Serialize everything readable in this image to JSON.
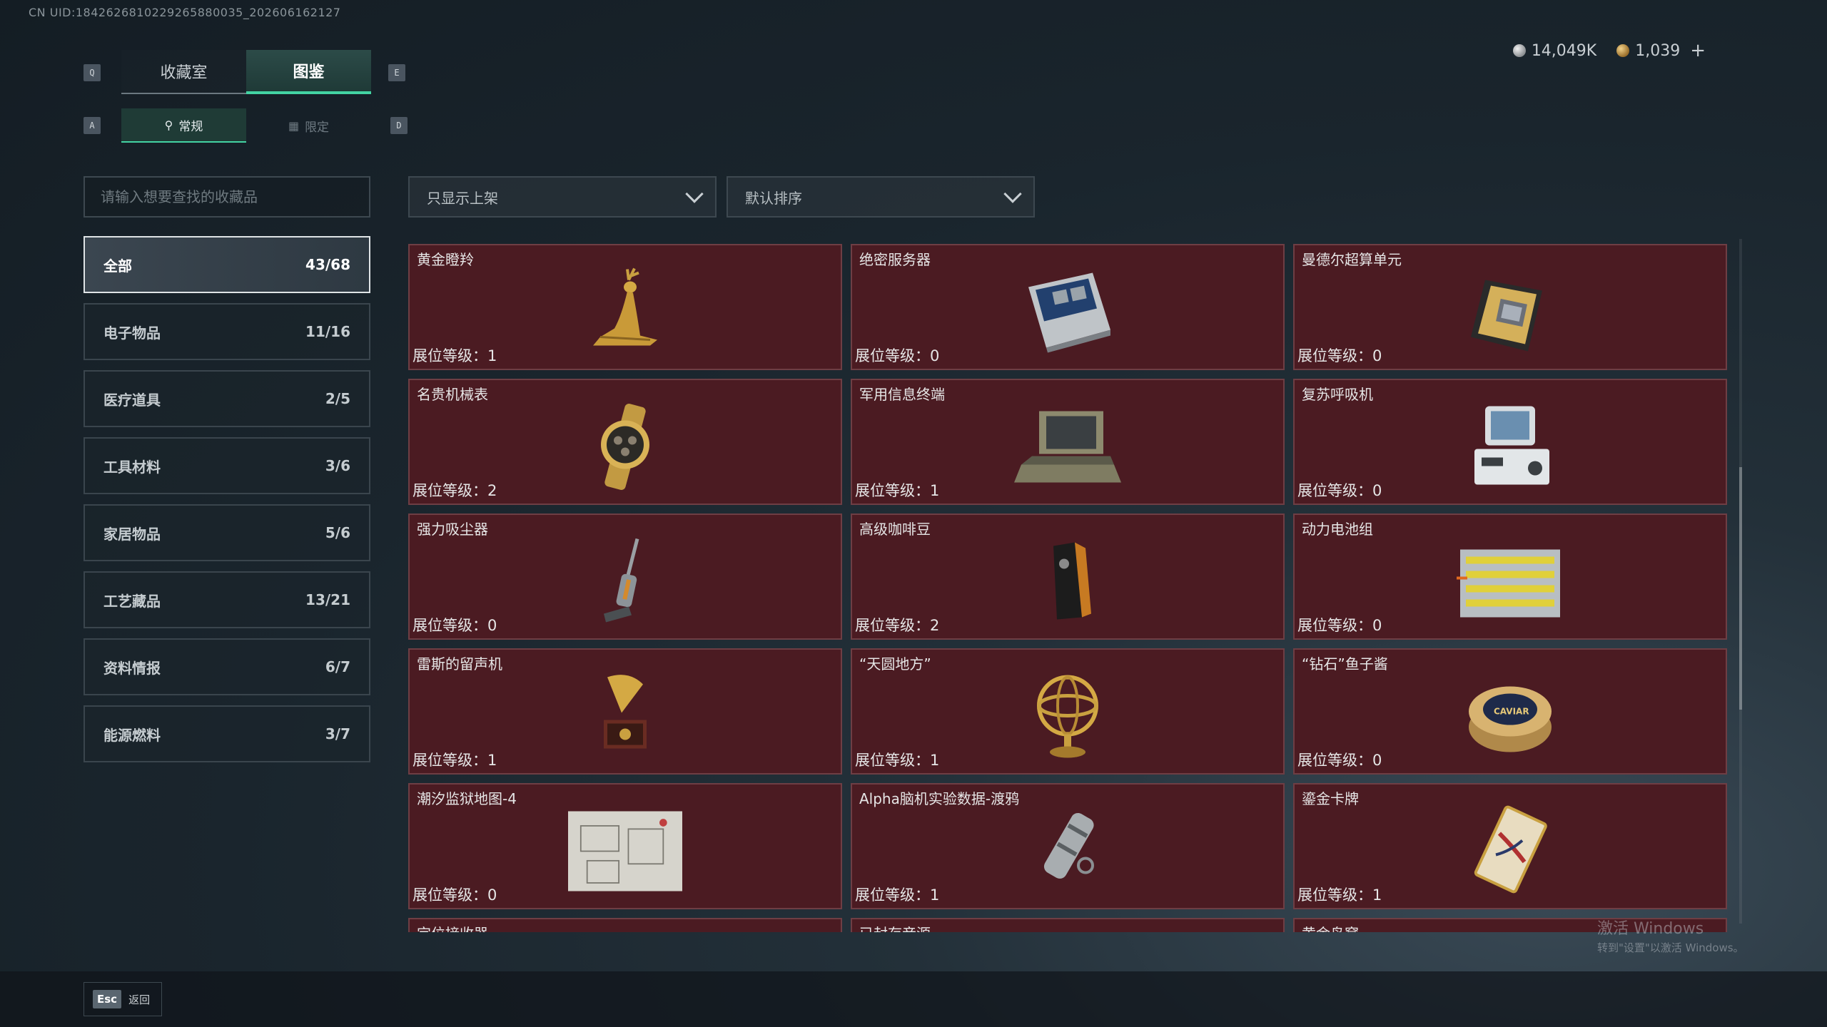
{
  "uid": "CN UID:1842626810229265880035_202606162127",
  "currency": {
    "silver": "14,049K",
    "gold": "1,039",
    "add": "+"
  },
  "keys": {
    "q": "Q",
    "e": "E",
    "a": "A",
    "d": "D"
  },
  "main_tabs": [
    "收藏室",
    "图鉴"
  ],
  "sub_tabs": [
    "常规",
    "限定"
  ],
  "search": {
    "placeholder": "请输入想要查找的收藏品"
  },
  "filters": {
    "show": "只显示上架",
    "sort": "默认排序"
  },
  "categories": [
    {
      "name": "全部",
      "count": "43/68"
    },
    {
      "name": "电子物品",
      "count": "11/16"
    },
    {
      "name": "医疗道具",
      "count": "2/5"
    },
    {
      "name": "工具材料",
      "count": "3/6"
    },
    {
      "name": "家居物品",
      "count": "5/6"
    },
    {
      "name": "工艺藏品",
      "count": "13/21"
    },
    {
      "name": "资料情报",
      "count": "6/7"
    },
    {
      "name": "能源燃料",
      "count": "3/7"
    }
  ],
  "items": [
    {
      "name": "黄金瞪羚",
      "level": "展位等级：1",
      "icon": "golden-gazelle-icon"
    },
    {
      "name": "绝密服务器",
      "level": "展位等级：0",
      "icon": "server-icon"
    },
    {
      "name": "曼德尔超算单元",
      "level": "展位等级：0",
      "icon": "supercomputer-unit-icon"
    },
    {
      "name": "名贵机械表",
      "level": "展位等级：2",
      "icon": "watch-icon"
    },
    {
      "name": "军用信息终端",
      "level": "展位等级：1",
      "icon": "military-terminal-icon"
    },
    {
      "name": "复苏呼吸机",
      "level": "展位等级：0",
      "icon": "ventilator-icon"
    },
    {
      "name": "强力吸尘器",
      "level": "展位等级：0",
      "icon": "vacuum-cleaner-icon"
    },
    {
      "name": "高级咖啡豆",
      "level": "展位等级：2",
      "icon": "coffee-beans-icon"
    },
    {
      "name": "动力电池组",
      "level": "展位等级：0",
      "icon": "battery-pack-icon"
    },
    {
      "name": "雷斯的留声机",
      "level": "展位等级：1",
      "icon": "gramophone-icon"
    },
    {
      "name": "“天圆地方”",
      "level": "展位等级：1",
      "icon": "armillary-sphere-icon"
    },
    {
      "name": "“钻石”鱼子酱",
      "level": "展位等级：0",
      "icon": "caviar-tin-icon"
    },
    {
      "name": "潮汐监狱地图-4",
      "level": "展位等级：0",
      "icon": "prison-map-icon"
    },
    {
      "name": "Alpha脑机实验数据-渡鸦",
      "level": "展位等级：1",
      "icon": "data-canister-icon"
    },
    {
      "name": "鎏金卡牌",
      "level": "展位等级：1",
      "icon": "gilded-card-icon"
    },
    {
      "name": "定位接收器",
      "level": "",
      "icon": ""
    },
    {
      "name": "已封存音源",
      "level": "",
      "icon": ""
    },
    {
      "name": "黄金鸟窝",
      "level": "",
      "icon": ""
    }
  ],
  "caviar_label": "CAVIAR",
  "bottom": {
    "esc_key": "Esc",
    "back": "返回"
  },
  "watermark": {
    "line1": "激活 Windows",
    "line2": "转到\"设置\"以激活 Windows。"
  },
  "colors": {
    "accent": "#43d3a3",
    "card_bg": "#4b1b22",
    "card_border": "#6e3e44"
  }
}
